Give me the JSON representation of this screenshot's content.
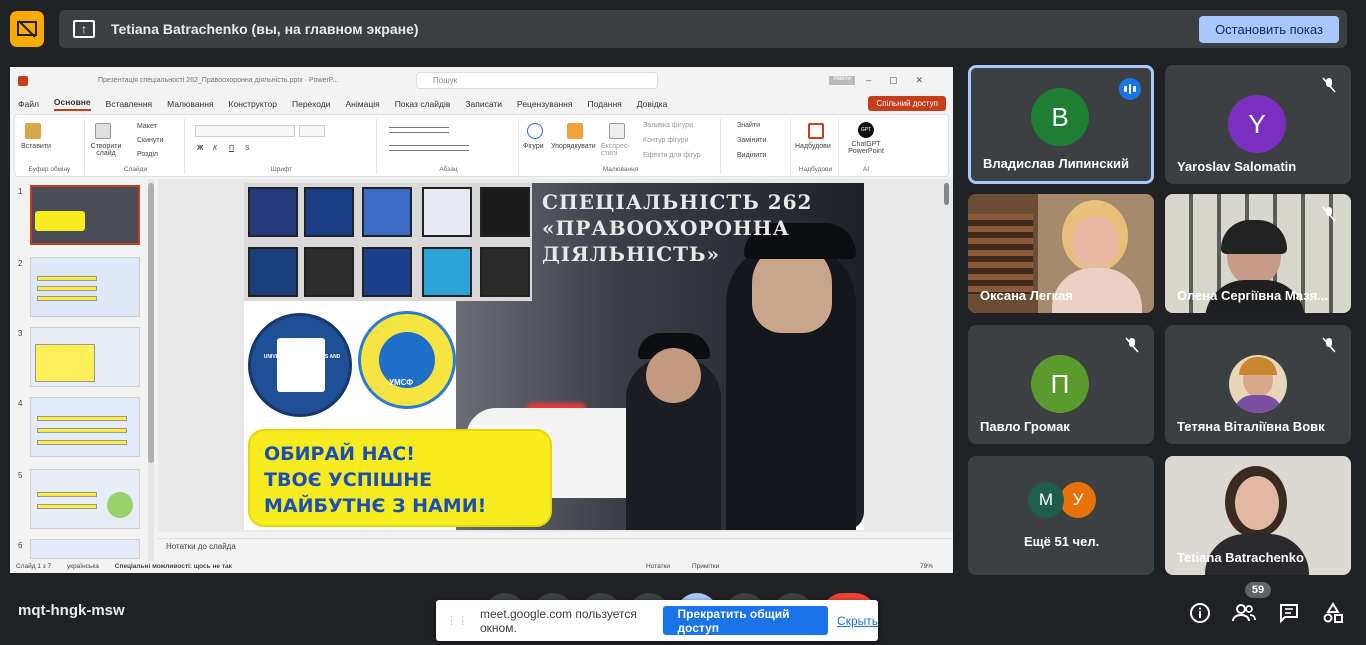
{
  "banner": {
    "presenter_text": "Tetiana Batrachenko (вы, на главном экране)",
    "stop_button": "Остановить показ"
  },
  "powerpoint": {
    "window_title": "Презентація спеціальності 262_Правоохоронна діяльність.pptx  ·  PowerP...",
    "search_placeholder": "Пошук",
    "user_chip": "Увійти",
    "menu": [
      "Файл",
      "Основне",
      "Вставлення",
      "Малювання",
      "Конструктор",
      "Переходи",
      "Анімація",
      "Показ слайдів",
      "Записати",
      "Рецензування",
      "Подання",
      "Довідка"
    ],
    "share_button": "Спільний доступ",
    "ribbon": {
      "clipboard": {
        "paste": "Вставити",
        "group": "Буфер обміну"
      },
      "slides": {
        "new_slide": "Створити слайд",
        "layout": "Макет",
        "reset": "Скинути",
        "section": "Розділ",
        "group": "Слайди"
      },
      "font": {
        "bold": "Ж",
        "italic": "К",
        "underline": "П",
        "strike": "S",
        "group": "Шрифт"
      },
      "paragraph": {
        "group": "Абзац"
      },
      "drawing": {
        "shapes": "Фігури",
        "arrange": "Упорядкувати",
        "styles": "Експрес-стилі",
        "fill": "Заливка фігури",
        "outline": "Контур фігури",
        "effects": "Ефекти для фігур",
        "group": "Малювання"
      },
      "editing": {
        "find": "Знайти",
        "replace": "Замінити",
        "select": "Виділити"
      },
      "addins": {
        "label": "Надбудови",
        "group": "Надбудови"
      },
      "ai": {
        "label": "ChatGPT PowerPoint",
        "group": "AI",
        "badge": "GPT"
      }
    },
    "thumbnails": [
      "1",
      "2",
      "3",
      "4",
      "5",
      "6"
    ],
    "slide": {
      "title": "СПЕЦІАЛЬНІСТЬ 262 «ПРАВООХОРОННА ДІЯЛЬНІСТЬ»",
      "slogan_lines": [
        "ОБИРАЙ НАС!",
        "ТВОЄ УСПІШНЕ",
        "МАЙБУТНЄ З НАМИ!"
      ],
      "emblem_text": "UNIVERSITY OF CUSTOMS AND FINANCE",
      "emblem_b_text": "УМСФ"
    },
    "notes_placeholder": "Нотатки до слайда",
    "status": {
      "slide_of": "Слайд 1 з 7",
      "language": "українська",
      "accessibility": "Спеціальні можливості: щось не так",
      "notes": "Нотатки",
      "comments": "Примітки",
      "zoom": "79%"
    }
  },
  "participants": [
    {
      "name": "Владислав Липинский",
      "initial": "В",
      "color": "#1e7e34",
      "speaking": true,
      "muted": false
    },
    {
      "name": "Yaroslav Salomatin",
      "initial": "Y",
      "color": "#7b2fbe",
      "speaking": false,
      "muted": true
    },
    {
      "name": "Оксана Легкая",
      "video": true,
      "muted": false
    },
    {
      "name": "Олена Сергіївна Мазя...",
      "video": true,
      "muted": true
    },
    {
      "name": "Павло Громак",
      "initial": "П",
      "color": "#5b9a2c",
      "muted": true
    },
    {
      "name": "Тетяна Віталіївна Вовк",
      "photo": true,
      "muted": true
    },
    {
      "name": "Ещё 51 чел.",
      "initials": [
        "М",
        "У"
      ],
      "colors": [
        "#1d5e4a",
        "#e8710a"
      ]
    },
    {
      "name": "Tetiana Batrachenko",
      "video": true
    }
  ],
  "bottom": {
    "meeting_code": "mqt-hngk-msw",
    "participant_count": "59",
    "share_message": "meet.google.com пользуется окном.",
    "stop_sharing": "Прекратить общий доступ",
    "hide": "Скрыть"
  }
}
